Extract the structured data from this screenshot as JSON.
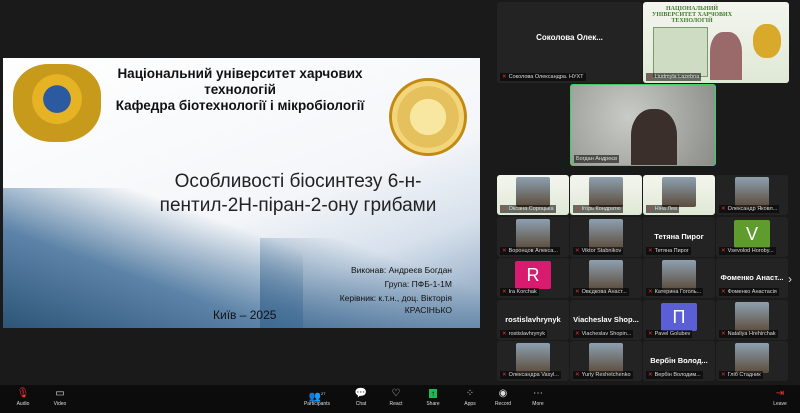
{
  "slide": {
    "university": "Національний університет харчових технологій",
    "department": "Кафедра біотехнології і мікробіології",
    "title": "Особливості біосинтезу 6-н-пентил-2Н-піран-2-ону грибами",
    "author": "Виконав: Андреєв Богдан",
    "group": "Група: ПФБ-1-1М",
    "supervisor": "Керівник: к.т.н., доц. Вікторія КРАСІНЬКО",
    "city_year": "Київ – 2025"
  },
  "top_tiles": [
    {
      "big": "Соколова  Олек...",
      "name": "Соколова Олександра. НУХТ"
    },
    {
      "banner": "НАЦІОНАЛЬНИЙ УНІВЕРСИТЕТ ХАРЧОВИХ ТЕХНОЛОГІЙ",
      "name": "Liudmyla Lazebna"
    },
    {
      "name": "Богдан Андреєв",
      "active_speaker": true
    }
  ],
  "gallery": [
    {
      "name": "Оксана Сороцька",
      "type": "logo"
    },
    {
      "name": "Ігорь Кондратю",
      "type": "logo"
    },
    {
      "name": "Ніна Лев",
      "type": "logo"
    },
    {
      "name": "Олександр Яковл...",
      "type": "photo"
    },
    {
      "name": "Воронцов Алекса...",
      "type": "photo"
    },
    {
      "name": "Viktor Stabnikov",
      "type": "photo"
    },
    {
      "name": "Тетяна Пирог",
      "big": "Тетяна Пирог"
    },
    {
      "name": "Vsevolod Horoby...",
      "avatar": "V",
      "color": "#5e9c2e"
    },
    {
      "name": "Ira Korchak",
      "avatar": "R",
      "color": "#d81b6e"
    },
    {
      "name": "Овєдкова Анаст...",
      "type": "photo"
    },
    {
      "name": "Катерина Гоголь...",
      "type": "photo"
    },
    {
      "name": "Фоменко Анастасія",
      "big": "Фоменко  Анаст..."
    },
    {
      "name": "rostislavhrynyk",
      "big": "rostislavhrynyk"
    },
    {
      "name": "Viacheslav Shopin...",
      "big": "Viacheslav  Shop..."
    },
    {
      "name": "Pavel Golubev",
      "avatar": "П",
      "color": "#5a5fd6"
    },
    {
      "name": "Nataliya Hrehirchak",
      "type": "photo"
    },
    {
      "name": "Олександра Vasyl...",
      "type": "photo"
    },
    {
      "name": "Yuriy Reshetchenko",
      "type": "photo"
    },
    {
      "name": "Вербін Володим...",
      "big": "Вербін  Волод..."
    },
    {
      "name": "Гліб Стадник",
      "type": "photo"
    }
  ],
  "toolbar": {
    "audio": "Audio",
    "video": "Video",
    "participants": "Participants",
    "participants_count": "27",
    "chat": "Chat",
    "react": "React",
    "share": "Share",
    "apps": "Apps",
    "record": "Record",
    "more": "More",
    "leave": "Leave"
  }
}
